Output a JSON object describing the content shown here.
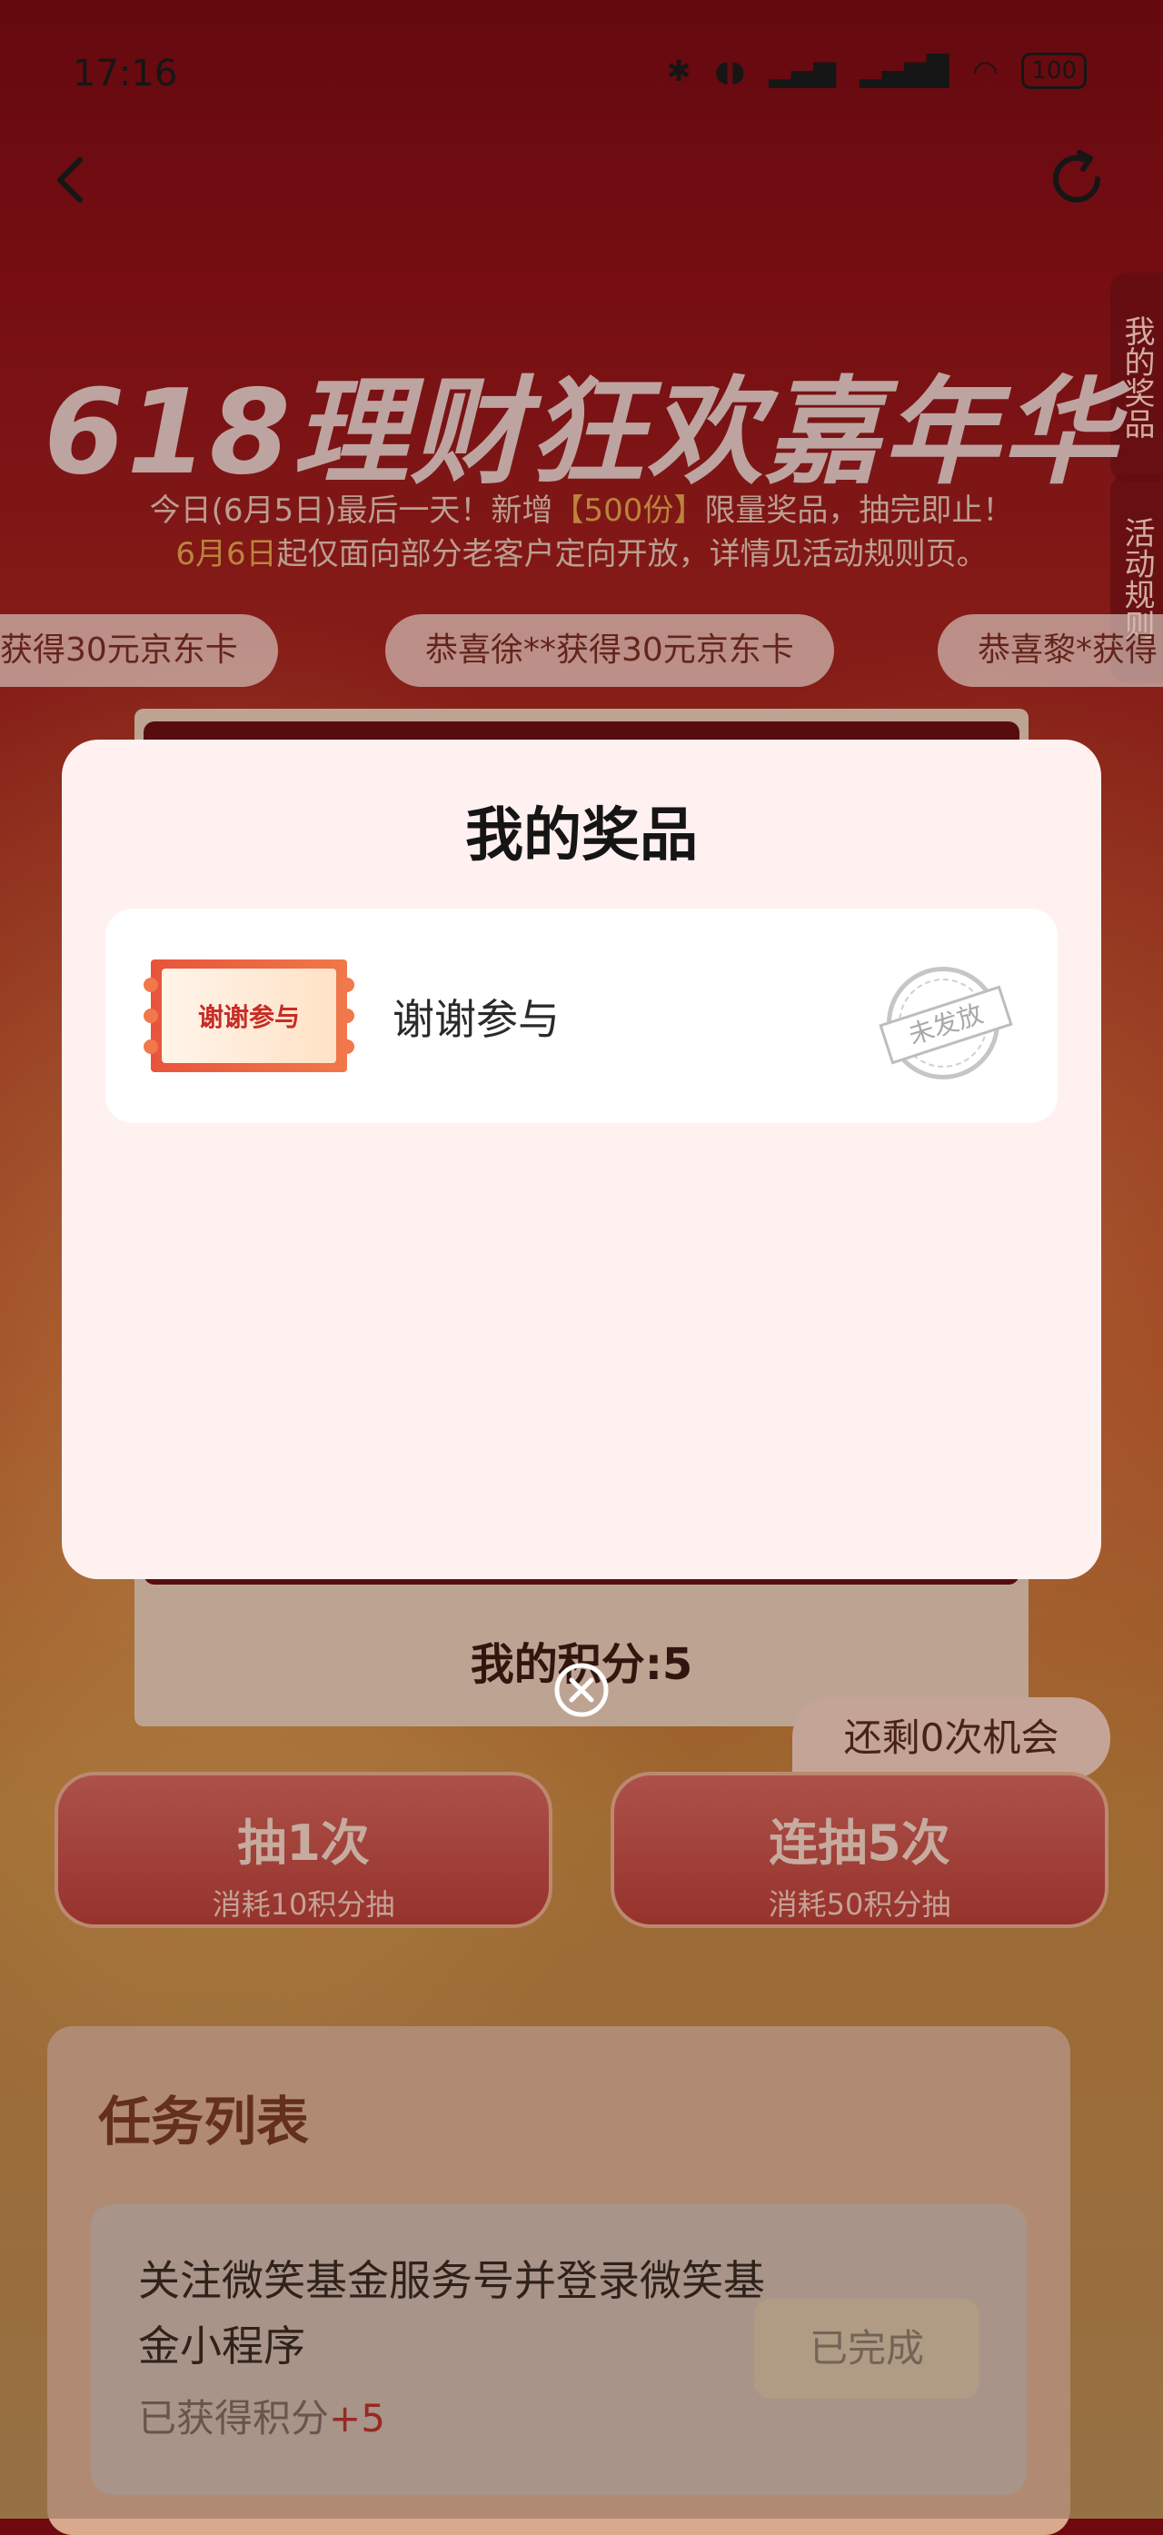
{
  "status_bar": {
    "time": "17:16",
    "battery": "100"
  },
  "side_tabs": {
    "my_prizes": "我的奖品",
    "rules": "活动规则"
  },
  "hero": {
    "title": "618理财狂欢嘉年华",
    "sub1_a": "今日(6月5日)最后一天！新增",
    "sub1_hl": "【500份】",
    "sub1_b": "限量奖品，抽完即止！",
    "sub2_hl": "6月6日",
    "sub2_b": "起仅面向部分老客户定向开放，详情见活动规则页。"
  },
  "ticker": [
    "获得30元京东卡",
    "恭喜徐**获得30元京东卡",
    "恭喜黎*获得"
  ],
  "lottery": {
    "points_label": "我的积分:5",
    "chances": "还剩0次机会",
    "draw1": {
      "title": "抽1次",
      "cost": "消耗10积分抽"
    },
    "draw5": {
      "title": "连抽5次",
      "cost": "消耗50积分抽"
    }
  },
  "tasks": {
    "title": "任务列表",
    "items": [
      {
        "text": "关注微笑基金服务号并登录微笑基金小程序",
        "points_label": "已获得积分",
        "points_value": "+5",
        "button": "已完成"
      }
    ]
  },
  "modal": {
    "title": "我的奖品",
    "prizes": [
      {
        "ticket_text": "谢谢参与",
        "name": "谢谢参与",
        "stamp": "未发放"
      }
    ]
  },
  "colors": {
    "accent": "#e8543a",
    "modal_bg": "#fff1f0",
    "bg_top": "#7a0c12"
  }
}
